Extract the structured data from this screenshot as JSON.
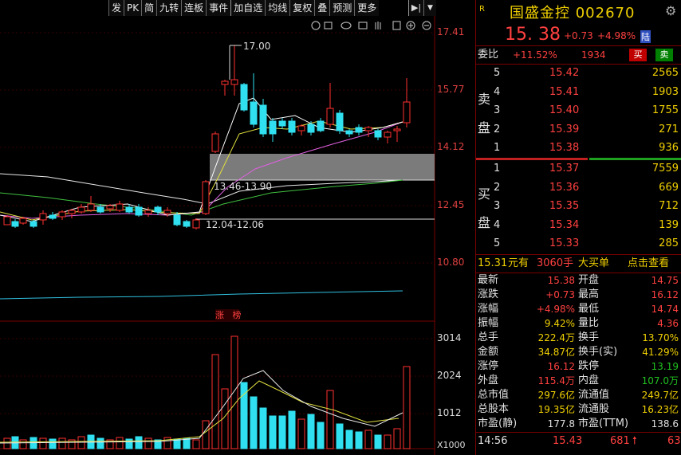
{
  "toolbar": [
    "发",
    "PK",
    "简",
    "九转",
    "连板",
    "事件",
    "加自选",
    "均线",
    "复权",
    "叠",
    "预测",
    "更多"
  ],
  "chart": {
    "price_ticks": [
      "17.41",
      "15.77",
      "14.12",
      "12.45",
      "10.80"
    ],
    "vol_ticks": [
      "3014",
      "2024",
      "1012",
      "X1000"
    ],
    "high_label": "17.00",
    "range1_label": "13.46-13.90",
    "range2_label": "12.04-12.06",
    "zt_label": "涨",
    "bang_label": "榜"
  },
  "header": {
    "r_badge": "R",
    "name": "国盛金控 002670",
    "price": "15. 38",
    "change": "+0.73",
    "pct": "+4.98%",
    "lu": "陆"
  },
  "weibi": {
    "label": "委比",
    "value": "+11.52%",
    "diff": "1934",
    "sell_btn": "买",
    "buy_btn": "卖"
  },
  "asks": [
    {
      "level": "5",
      "price": "15.42",
      "vol": "2565"
    },
    {
      "level": "4",
      "price": "15.41",
      "vol": "1903"
    },
    {
      "level": "3",
      "price": "15.40",
      "vol": "1755"
    },
    {
      "level": "2",
      "price": "15.39",
      "vol": "271"
    },
    {
      "level": "1",
      "price": "15.38",
      "vol": "936"
    }
  ],
  "bids": [
    {
      "level": "1",
      "price": "15.37",
      "vol": "7559"
    },
    {
      "level": "2",
      "price": "15.36",
      "vol": "669"
    },
    {
      "level": "3",
      "price": "15.35",
      "vol": "712"
    },
    {
      "level": "4",
      "price": "15.34",
      "vol": "139"
    },
    {
      "level": "5",
      "price": "15.33",
      "vol": "285"
    }
  ],
  "ask_side": [
    "卖",
    "盘"
  ],
  "bid_side": [
    "买",
    "盘"
  ],
  "bigorder": {
    "price": "15.31",
    "text1": "元有",
    "qty": "3060手",
    "text2": "大买单",
    "link": "点击查看"
  },
  "stats": [
    {
      "l1": "最新",
      "v1": "15.38",
      "c1": "red",
      "l2": "开盘",
      "v2": "14.75",
      "c2": "red"
    },
    {
      "l1": "涨跌",
      "v1": "+0.73",
      "c1": "red",
      "l2": "最高",
      "v2": "16.12",
      "c2": "red"
    },
    {
      "l1": "涨幅",
      "v1": "+4.98%",
      "c1": "red",
      "l2": "最低",
      "v2": "14.74",
      "c2": "red"
    },
    {
      "l1": "振幅",
      "v1": "9.42%",
      "c1": "yellow",
      "l2": "量比",
      "v2": "4.36",
      "c2": "red"
    },
    {
      "l1": "总手",
      "v1": "222.4万",
      "c1": "yellow",
      "l2": "换手",
      "v2": "13.70%",
      "c2": "yellow"
    },
    {
      "l1": "金额",
      "v1": "34.87亿",
      "c1": "yellow",
      "l2": "换手(实)",
      "v2": "41.29%",
      "c2": "yellow"
    },
    {
      "l1": "涨停",
      "v1": "16.12",
      "c1": "red",
      "l2": "跌停",
      "v2": "13.19",
      "c2": "green"
    },
    {
      "l1": "外盘",
      "v1": "115.4万",
      "c1": "red",
      "l2": "内盘",
      "v2": "107.0万",
      "c2": "green"
    },
    {
      "l1": "总市值",
      "v1": "297.6亿",
      "c1": "yellow",
      "l2": "流通值",
      "v2": "249.7亿",
      "c2": "yellow"
    },
    {
      "l1": "总股本",
      "v1": "19.35亿",
      "c1": "yellow",
      "l2": "流通股",
      "v2": "16.23亿",
      "c2": "yellow"
    },
    {
      "l1": "市盈(静)",
      "v1": "177.8",
      "c1": "white",
      "l2": "市盈(TTM)",
      "v2": "138.6",
      "c2": "white"
    }
  ],
  "tick": {
    "time": "14:56",
    "price": "15.43",
    "vol": "681",
    "count": "63"
  },
  "colors": {
    "up": "#ff3030",
    "down": "#30e0f0",
    "bg": "#000000"
  }
}
